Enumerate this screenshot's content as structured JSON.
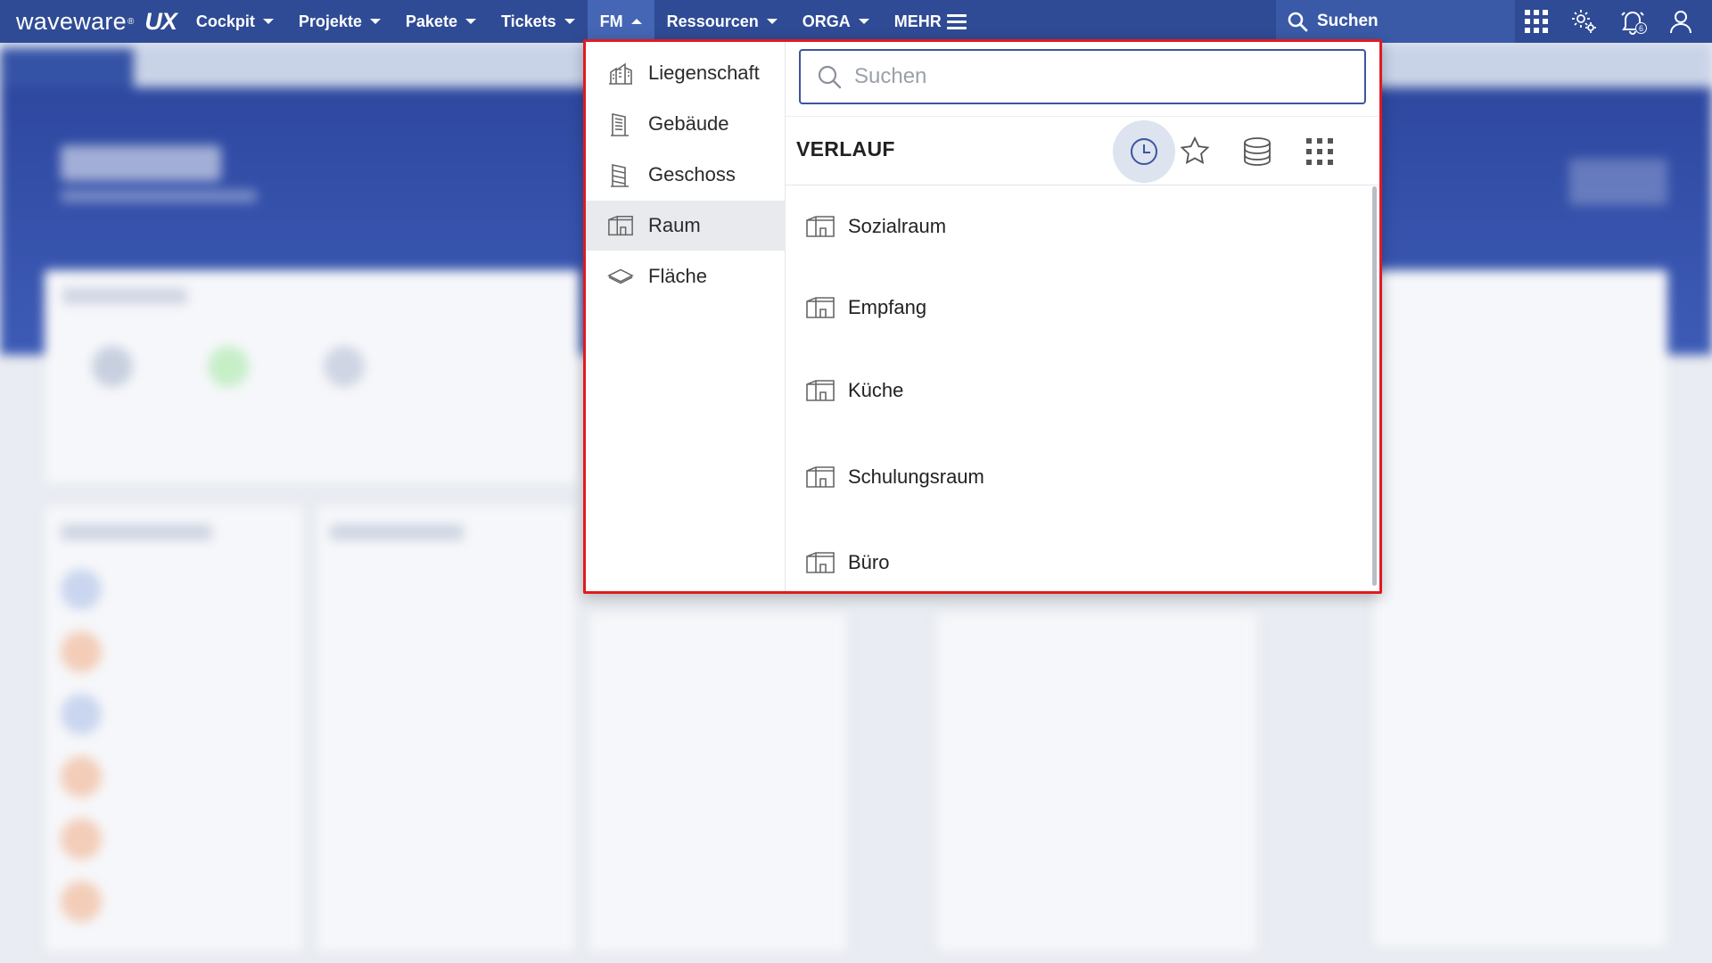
{
  "topbar": {
    "brand": "waveware",
    "brand_mark": "®",
    "brand_suffix": "UX",
    "nav": [
      {
        "label": "Cockpit",
        "state": "collapsed"
      },
      {
        "label": "Projekte",
        "state": "collapsed"
      },
      {
        "label": "Pakete",
        "state": "collapsed"
      },
      {
        "label": "Tickets",
        "state": "collapsed"
      },
      {
        "label": "FM",
        "state": "expanded"
      },
      {
        "label": "Ressourcen",
        "state": "collapsed"
      },
      {
        "label": "ORGA",
        "state": "collapsed"
      },
      {
        "label": "MEHR"
      }
    ],
    "search_label": "Suchen",
    "notification_count": "6",
    "icons": [
      "apps-grid-icon",
      "settings-gear-icon",
      "notification-bell-icon",
      "user-icon"
    ]
  },
  "fm_menu": {
    "categories": [
      {
        "label": "Liegenschaft",
        "icon": "estate-icon"
      },
      {
        "label": "Gebäude",
        "icon": "building-icon"
      },
      {
        "label": "Geschoss",
        "icon": "floor-icon"
      },
      {
        "label": "Raum",
        "icon": "room-icon",
        "selected": true
      },
      {
        "label": "Fläche",
        "icon": "area-icon"
      }
    ],
    "search_placeholder": "Suchen",
    "section_title": "VERLAUF",
    "modes": [
      {
        "icon": "history-clock-icon",
        "active": true
      },
      {
        "icon": "favorites-star-icon"
      },
      {
        "icon": "database-icon"
      },
      {
        "icon": "all-grid-icon"
      }
    ],
    "items": [
      {
        "label": "Sozialraum",
        "icon": "room-icon"
      },
      {
        "label": "Empfang",
        "icon": "room-icon"
      },
      {
        "label": "Küche",
        "icon": "room-icon"
      },
      {
        "label": "Schulungsraum",
        "icon": "room-icon"
      },
      {
        "label": "Büro",
        "icon": "room-icon"
      }
    ]
  },
  "colors": {
    "topbar": "#2f4b95",
    "active_nav": "#4466b4",
    "highlight_border": "#e01a22",
    "search_border": "#3b55a0"
  }
}
